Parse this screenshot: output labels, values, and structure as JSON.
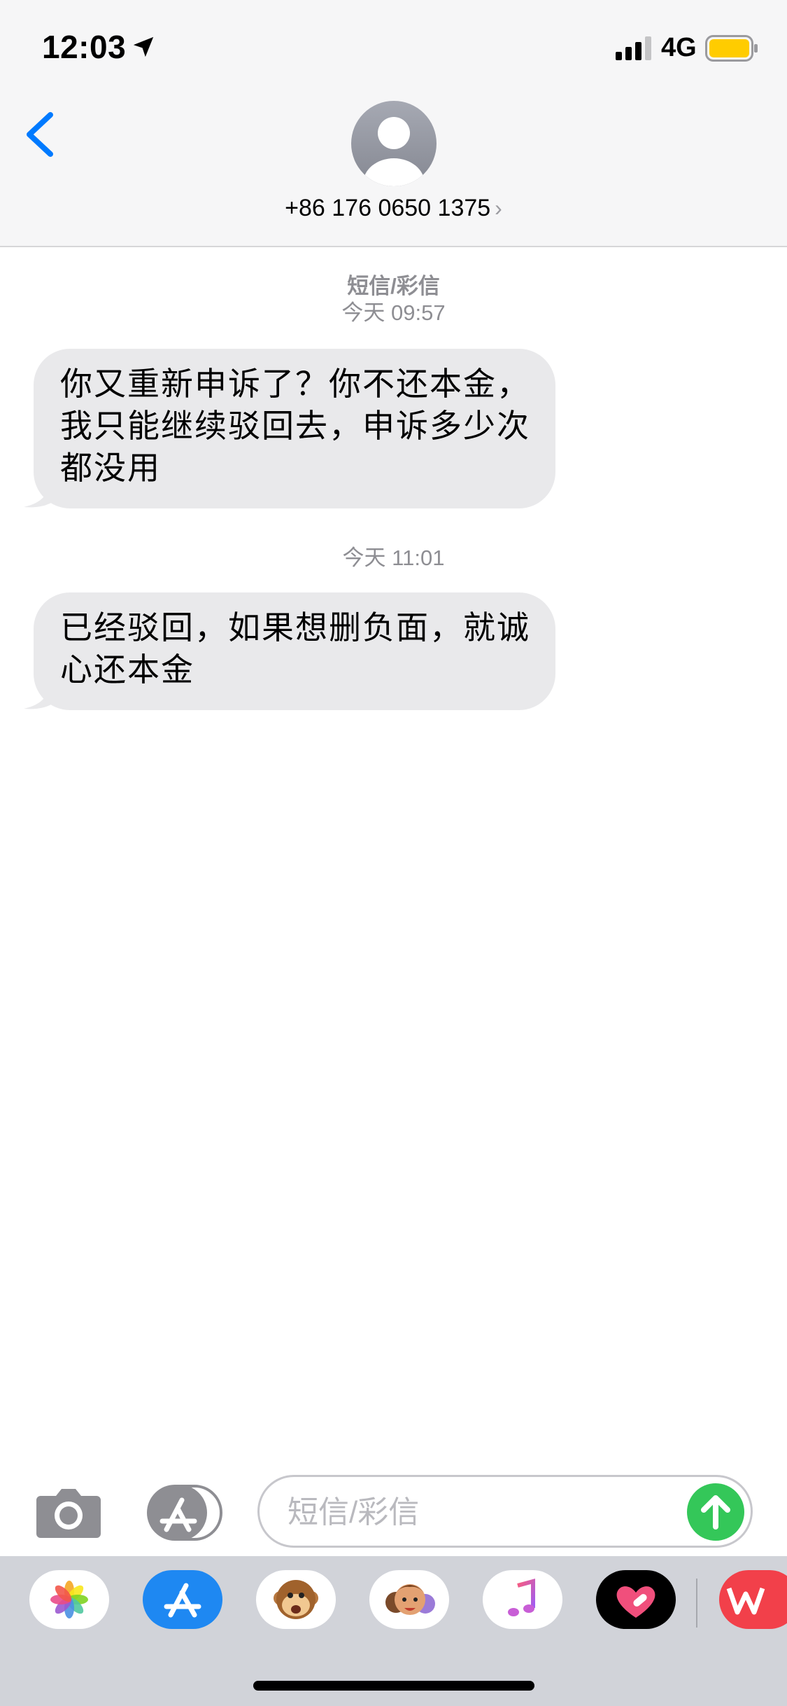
{
  "status_bar": {
    "time": "12:03",
    "network": "4G",
    "battery_color": "#ffcc00",
    "signal_bars": 3
  },
  "header": {
    "contact": "+86 176 0650 1375",
    "accent": "#007aff"
  },
  "conversation": {
    "groups": [
      {
        "service": "短信/彩信",
        "timestamp": "今天 09:57",
        "message": "你又重新申诉了？你不还本金，我只能继续驳回去，申诉多少次都没用"
      },
      {
        "timestamp": "今天 11:01",
        "message": "已经驳回，如果想删负面，就诚心还本金"
      }
    ]
  },
  "composer": {
    "placeholder": "短信/彩信",
    "send_color": "#34c759"
  },
  "app_drawer": {
    "apps": [
      "photos-icon",
      "app-store-icon",
      "animoji-icon",
      "memoji-icon",
      "music-icon",
      "heart-app-icon",
      "wps-icon"
    ]
  }
}
